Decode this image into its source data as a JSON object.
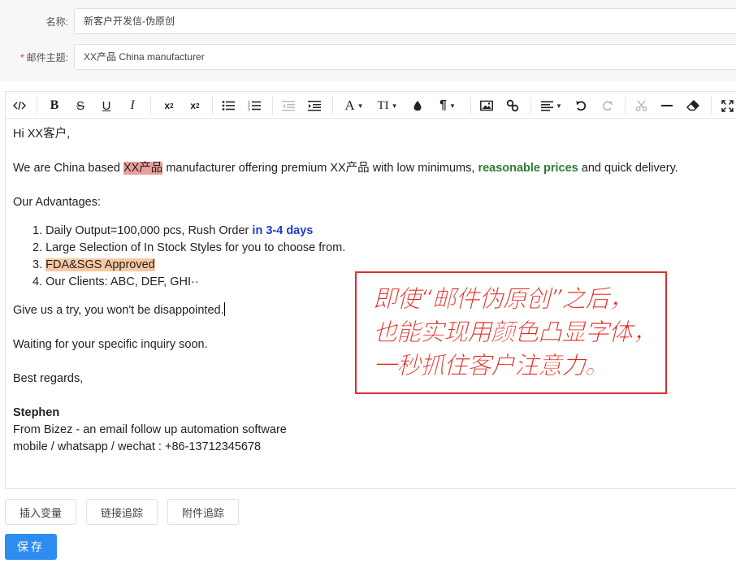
{
  "form": {
    "name_label": "名称:",
    "name_value": "新客户开发信-伪原创",
    "subject_required": "*",
    "subject_label": "邮件主题:",
    "subject_value": "XX产品 China manufacturer"
  },
  "toolbar": {
    "items": [
      "code-view",
      "bold",
      "strikethrough",
      "underline",
      "italic",
      "superscript",
      "subscript",
      "bullet-list",
      "numbered-list",
      "outdent",
      "indent",
      "font-color",
      "font-size",
      "background-color",
      "paragraph",
      "image",
      "link",
      "align",
      "undo",
      "redo",
      "cut",
      "horizontal-rule",
      "clear-format",
      "fullscreen"
    ],
    "font_color_glyph": "A",
    "font_size_glyph": "TI",
    "paragraph_glyph": "¶",
    "bold_glyph": "B",
    "strike_glyph": "S",
    "underline_glyph": "U",
    "italic_glyph": "I"
  },
  "content": {
    "greeting": "Hi XX客户,",
    "intro_1": "We are China based ",
    "intro_highlight": "XX产品",
    "intro_2": " manufacturer offering premium XX产品 with low minimums, ",
    "intro_green": "reasonable prices",
    "intro_3": " and quick delivery.",
    "advantages_title": "Our Advantages:",
    "list_1_prefix": "1. Daily Output=100,000 pcs, Rush Order ",
    "list_1_bold": "in 3-4 days",
    "list_2": "2. Large Selection of In Stock Styles for you to choose from.",
    "list_3_num": "3. ",
    "list_3_highlight": "FDA&SGS Approved",
    "list_4": "4. Our Clients: ABC, DEF, GHI··",
    "try_line": "Give us a try, you won't be disappointed.",
    "waiting_line": "Waiting for your specific inquiry soon.",
    "regards": "Best regards,",
    "sig_name": "Stephen",
    "sig_from": "From Bizez  - an email follow up automation software",
    "sig_mobile": "mobile / whatsapp / wechat : +86-13712345678"
  },
  "annotation": {
    "line_1": "即使“邮件伪原创”之后，",
    "line_2": "也能实现用颜色凸显字体，",
    "line_3": "一秒抓住客户注意力。"
  },
  "buttons": {
    "insert_variable": "插入变量",
    "link_tracking": "链接追踪",
    "attachment_tracking": "附件追踪",
    "save": "保存"
  },
  "colors": {
    "highlight_red": "#e8a09a",
    "highlight_orange": "#f7c9a3",
    "green_text": "#2e7d32",
    "blue_text": "#1f3cc7",
    "annotation_red": "#e0281e",
    "save_button": "#2d8cf0"
  }
}
